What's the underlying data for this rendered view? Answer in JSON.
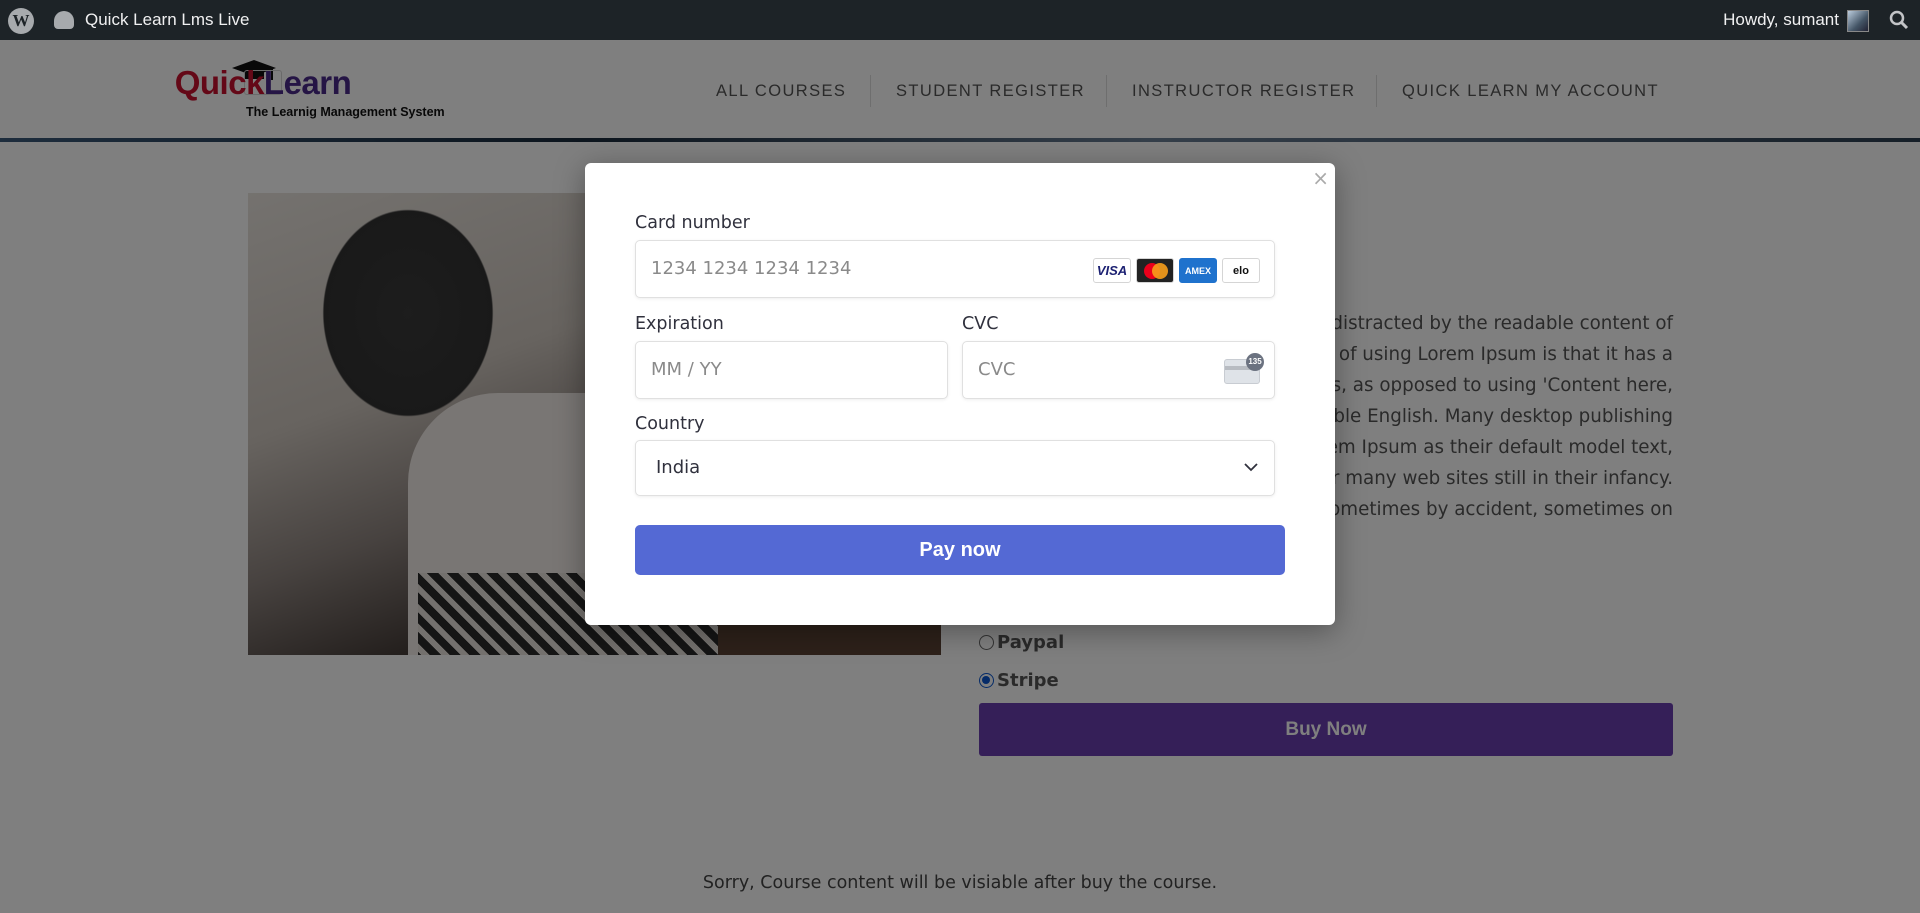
{
  "adminbar": {
    "site_name": "Quick Learn Lms Live",
    "howdy": "Howdy, sumant"
  },
  "logo": {
    "brand_part1": "Quick",
    "brand_part2": " Learn",
    "tagline": "The Learnig Management System"
  },
  "nav": {
    "items": [
      "ALL COURSES",
      "STUDENT REGISTER",
      "INSTRUCTOR REGISTER",
      "QUICK LEARN MY ACCOUNT"
    ]
  },
  "content": {
    "paragraph_lines": [
      "l be distracted by the readable content of",
      "nt of using Lorem Ipsum is that it has a",
      "rs, as opposed to using 'Content here,",
      "able English. Many desktop publishing",
      "orem Ipsum as their default model text,",
      "er many web sites still in their infancy.",
      "rs, sometimes by accident, sometimes on"
    ],
    "payment_options": [
      {
        "label": "Paypal",
        "selected": false
      },
      {
        "label": "Stripe",
        "selected": true
      }
    ],
    "buy_now_label": "Buy Now",
    "footer_note": "Sorry, Course content will be visiable after buy the course."
  },
  "modal": {
    "close_label": "×",
    "card_number_label": "Card number",
    "card_number_placeholder": "1234 1234 1234 1234",
    "card_brands": [
      "VISA",
      "mastercard",
      "AMEX",
      "elo"
    ],
    "expiration_label": "Expiration",
    "expiration_placeholder": "MM / YY",
    "cvc_label": "CVC",
    "cvc_placeholder": "CVC",
    "cvc_badge": "135",
    "country_label": "Country",
    "country_value": "India",
    "pay_button_label": "Pay now"
  },
  "colors": {
    "adminbar": "#1d2327",
    "buy_now": "#6a3fb0",
    "pay_now": "#5469d4",
    "brand_red": "#c8102e",
    "brand_purple": "#4b2a8a"
  }
}
